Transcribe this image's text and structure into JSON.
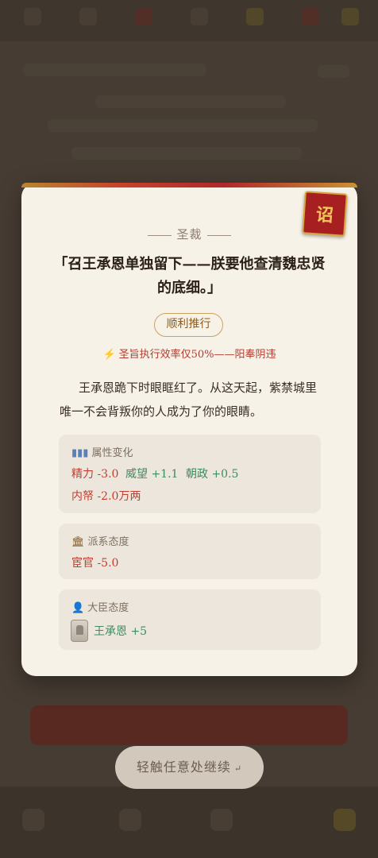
{
  "dialog": {
    "seal_text": "诏",
    "header": "圣裁",
    "decree": "「召王承恩单独留下——朕要他查清魏忠贤的底细。」",
    "outcome": "顺利推行",
    "efficiency_note": "圣旨执行效率仅50%——阳奉阴违",
    "narrative": "王承恩跪下时眼眶红了。从这天起，紫禁城里唯一不会背叛你的人成为了你的眼睛。",
    "attributes": {
      "title": "属性变化",
      "icon": "bar-chart-icon",
      "items": [
        {
          "label": "精力 -3.0",
          "tone": "negative"
        },
        {
          "label": "威望 +1.1",
          "tone": "positive"
        },
        {
          "label": "朝政 +0.5",
          "tone": "positive"
        },
        {
          "label": "内帑 -2.0万两",
          "tone": "negative"
        }
      ]
    },
    "factions": {
      "title": "派系态度",
      "icon": "palace-icon",
      "items": [
        {
          "label": "宦官 -5.0",
          "tone": "negative"
        }
      ]
    },
    "ministers": {
      "title": "大臣态度",
      "icon": "minister-icon",
      "items": [
        {
          "label": "王承恩 +5",
          "tone": "positive"
        }
      ]
    }
  },
  "continue_prompt": "轻触任意处继续",
  "colors": {
    "accent_red": "#a81f22",
    "gold": "#d8a73c",
    "negative": "#c23e30",
    "positive": "#3f8a5e"
  }
}
